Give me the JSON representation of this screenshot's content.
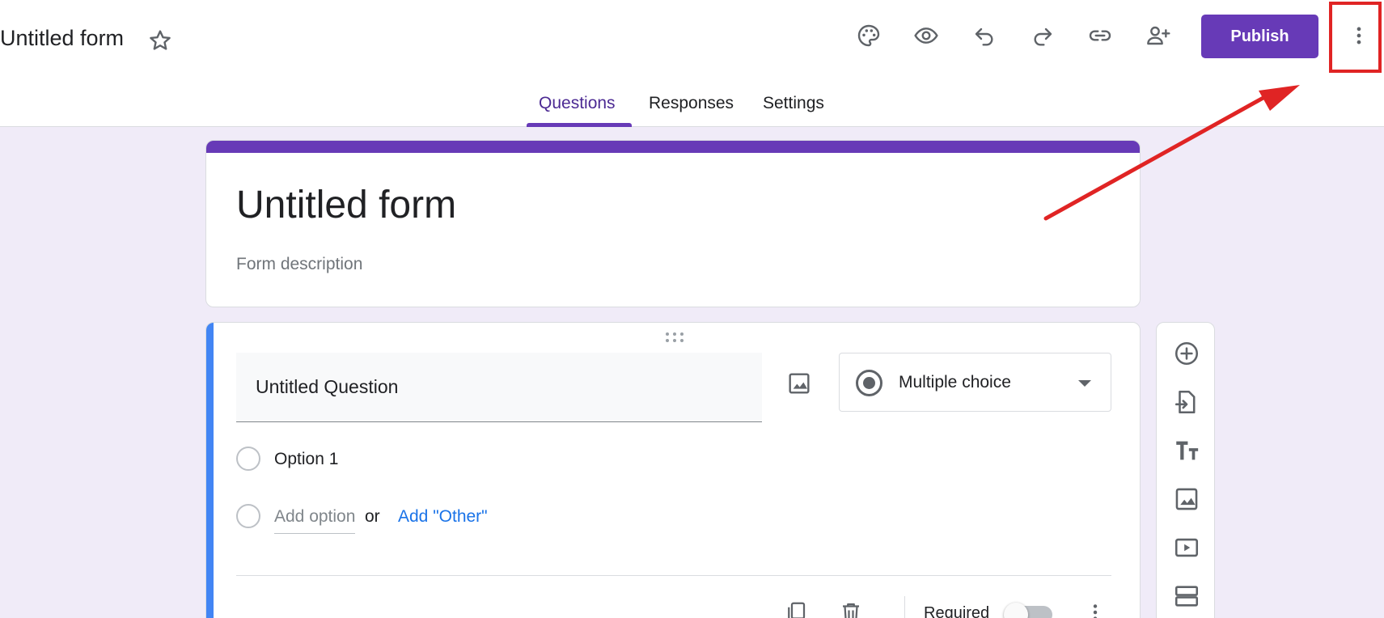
{
  "header": {
    "doc_title": "Untitled form",
    "star_icon": "star-outline-icon",
    "toolbar_icons": [
      "palette-icon",
      "eye-icon",
      "undo-icon",
      "redo-icon",
      "link-icon",
      "add-person-icon"
    ],
    "publish_label": "Publish",
    "more_icon": "more-vertical-icon"
  },
  "tabs": [
    {
      "label": "Questions",
      "active": true
    },
    {
      "label": "Responses",
      "active": false
    },
    {
      "label": "Settings",
      "active": false
    }
  ],
  "form": {
    "title": "Untitled form",
    "description_placeholder": "Form description",
    "accent_color": "#673ab7"
  },
  "question": {
    "title": "Untitled Question",
    "type": "Multiple choice",
    "options": [
      "Option 1"
    ],
    "add_option": "Add option",
    "or_text": "or",
    "add_other": "Add \"Other\"",
    "required_label": "Required",
    "required": false,
    "accent_color": "#4285f4"
  },
  "side_toolbar": [
    "add-question-icon",
    "import-questions-icon",
    "add-title-icon",
    "add-image-icon",
    "add-video-icon",
    "add-section-icon"
  ],
  "annotation": {
    "color": "#e02424",
    "target": "more-options-button"
  }
}
